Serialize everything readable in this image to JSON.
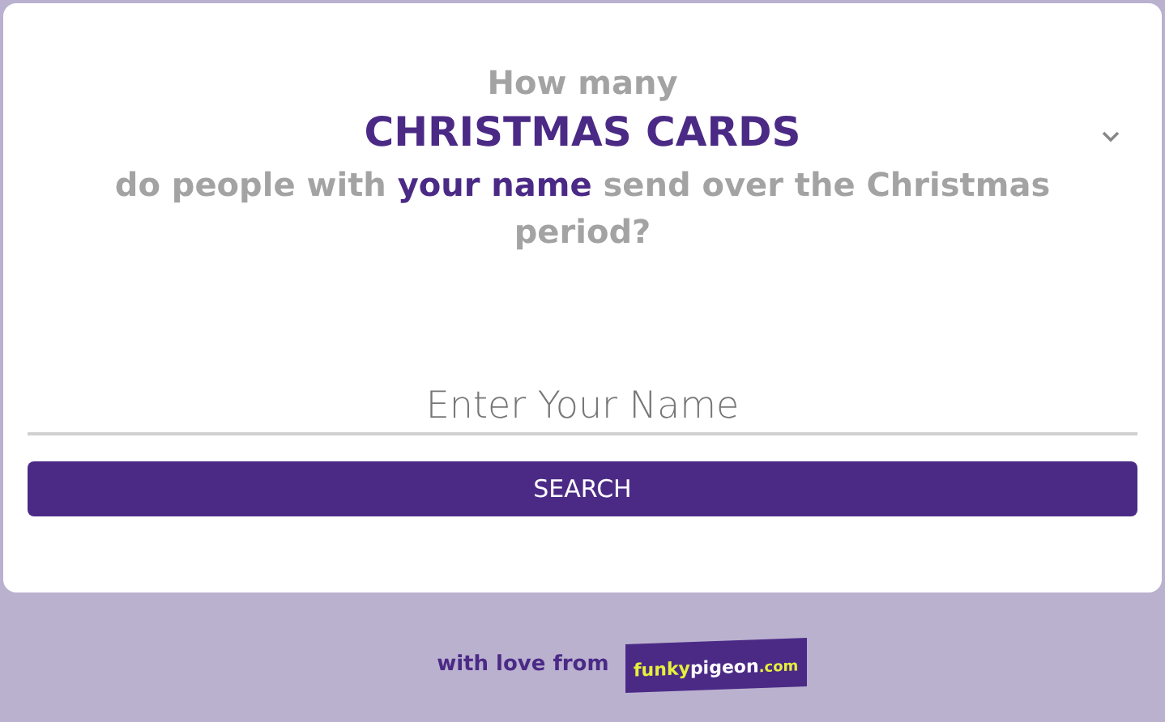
{
  "heading": {
    "intro": "How many",
    "topic": "CHRISTMAS CARDS",
    "question": [
      {
        "text": "do people with ",
        "highlight": false
      },
      {
        "text": "your name",
        "highlight": true
      },
      {
        "text": " send over the Christmas period?",
        "highlight": false
      }
    ]
  },
  "name_field": {
    "placeholder": "Enter Your Name"
  },
  "search_button": "SEARCH",
  "footer": {
    "text": "with love from",
    "logo": [
      "funky",
      "pigeon",
      ".com"
    ]
  }
}
